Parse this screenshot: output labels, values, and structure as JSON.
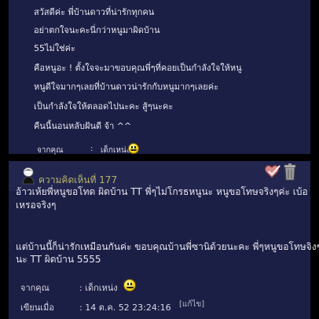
{
  "top_post": {
    "lines": [
      "สวัสดีค่ะ พี่บ้านดาวที่น่ารักทุกคน",
      "อย่าตกใจนะคะนี่กว่าหนูมาผิดบ้าน",
      "55ไม่ใช่ค่ะ",
      "คือหนูอะ ! ตั้งใจจะมาขอบคุณพี่ๆที่คอยเป็นกำลังใจให้หนู",
      "หนูดีใจมากๆเลยที่บ้านดาวน่ารักกับหนูมากๆเลยค่ะ",
      "เป็นกำลังใจให้ตลอดไปนะคะ สู้ๆนะคะ",
      "คืนนี้นอนหลับฝันดี จ้า ^^"
    ],
    "from_label": "จากคุณ",
    "from_sep": ":",
    "from_value": "เด็กเหน่ง"
  },
  "comment": {
    "title": "ความคิดเห็นที่ 177",
    "icons": [
      "heart-check-icon",
      "trash-bin-icon"
    ],
    "body": [
      "อ้าวเห้ยพี่หนูขอโทด ผิดบ้าน TT พี่ๆไม่โกรธหนูนะ หนูขอโทษจริงๆค่ะ เบ้อ",
      "เหรอจริงๆ",
      "แต่บ้านนี้ก็น่ารักเหมือนกันค่ะ ขอบคุณบ้านพี่ซานิด้วยนะคะ พี่ๆหนูขอโทษจิงๆ",
      "นะ TT ผิดบ้าน 5555"
    ],
    "from_label": "จากคุณ",
    "from_value": ": เด็กเหน่ง",
    "posted_label": "เขียนเมื่อ",
    "posted_value": ": 14 ต.ค. 52 23:24:16",
    "edit_link": "[แก้ไข]"
  },
  "colors": {
    "panel": "#1c1f45",
    "header_strip": "#22264f",
    "title_text": "#b9b36a",
    "body_text": "#e6e6f0"
  }
}
